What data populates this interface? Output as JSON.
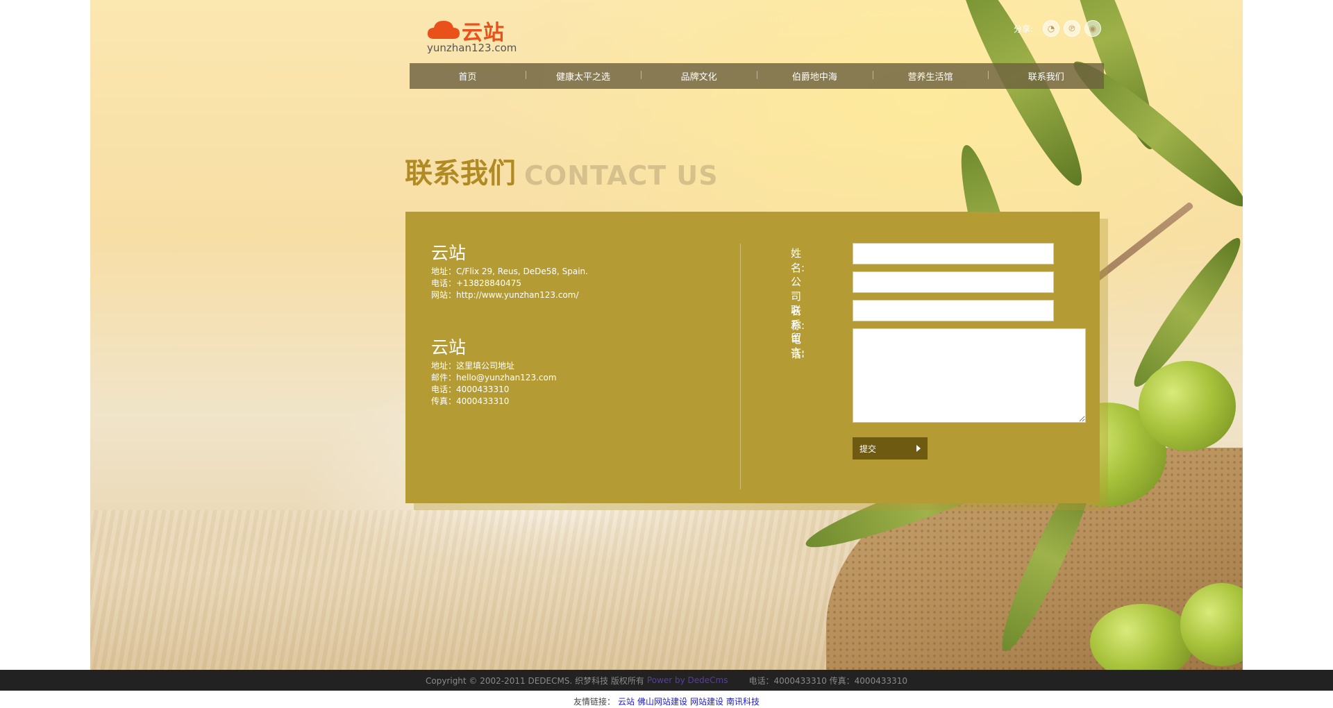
{
  "logo": {
    "brand": "云站",
    "url": "yunzhan123.com",
    "brand_color": "#e9501a"
  },
  "share": {
    "label": "分享:",
    "icons": [
      "wechat-icon",
      "pinterest-icon",
      "weibo-icon"
    ]
  },
  "nav": {
    "items": [
      "首页",
      "健康太平之选",
      "品牌文化",
      "伯爵地中海",
      "营养生活馆",
      "联系我们"
    ]
  },
  "heading": {
    "cn": "联系我们",
    "en": "CONTACT US"
  },
  "contact_blocks": [
    {
      "title": "云站",
      "lines": [
        "地址：C/Flix 29, Reus, DeDe58, Spain.",
        "电话：+13828840475",
        "网站：http://www.yunzhan123.com/"
      ]
    },
    {
      "title": "云站",
      "lines": [
        "地址：这里填公司地址",
        "邮件：hello@yunzhan123.com",
        "电话：4000433310",
        "传真：4000433310"
      ]
    }
  ],
  "form": {
    "name_label": "姓名:",
    "company_label": "公司名称:",
    "phone_label": "联系电话:",
    "message_label": "留言:",
    "name_value": "",
    "company_value": "",
    "phone_value": "",
    "message_value": "",
    "submit_label": "提交"
  },
  "footer": {
    "copyright": "Copyright © 2002-2011 DEDECMS. 织梦科技 版权所有",
    "power": "Power by DedeCms",
    "contact": "电话：4000433310 传真：4000433310"
  },
  "links": {
    "label": "友情链接：",
    "items": [
      "云站",
      "佛山网站建设",
      "网站建设",
      "南讯科技"
    ]
  },
  "colors": {
    "panel": "#b59b34",
    "heading": "#b08a22",
    "nav": "#6e6240",
    "footer": "#222222",
    "link": "#1a1ad8"
  }
}
